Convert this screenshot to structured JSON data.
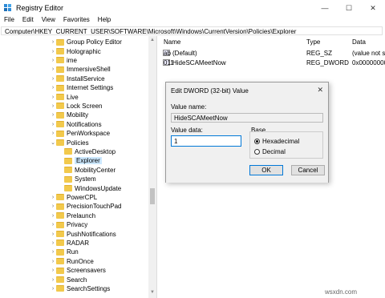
{
  "window": {
    "title": "Registry Editor"
  },
  "menu": [
    "File",
    "Edit",
    "View",
    "Favorites",
    "Help"
  ],
  "address": "Computer\\HKEY_CURRENT_USER\\SOFTWARE\\Microsoft\\Windows\\CurrentVersion\\Policies\\Explorer",
  "tree": [
    {
      "label": "Group Policy Editor",
      "level": 0,
      "expandable": true
    },
    {
      "label": "Holographic",
      "level": 0,
      "expandable": true
    },
    {
      "label": "ime",
      "level": 0,
      "expandable": true
    },
    {
      "label": "ImmersiveShell",
      "level": 0,
      "expandable": true
    },
    {
      "label": "InstallService",
      "level": 0,
      "expandable": true
    },
    {
      "label": "Internet Settings",
      "level": 0,
      "expandable": true
    },
    {
      "label": "Live",
      "level": 0,
      "expandable": true
    },
    {
      "label": "Lock Screen",
      "level": 0,
      "expandable": true
    },
    {
      "label": "Mobility",
      "level": 0,
      "expandable": true
    },
    {
      "label": "Notifications",
      "level": 0,
      "expandable": true
    },
    {
      "label": "PenWorkspace",
      "level": 0,
      "expandable": true
    },
    {
      "label": "Policies",
      "level": 0,
      "expandable": true,
      "expanded": true
    },
    {
      "label": "ActiveDesktop",
      "level": 1,
      "expandable": false
    },
    {
      "label": "Explorer",
      "level": 1,
      "expandable": false,
      "selected": true
    },
    {
      "label": "MobilityCenter",
      "level": 1,
      "expandable": false
    },
    {
      "label": "System",
      "level": 1,
      "expandable": false
    },
    {
      "label": "WindowsUpdate",
      "level": 1,
      "expandable": false
    },
    {
      "label": "PowerCPL",
      "level": 0,
      "expandable": true
    },
    {
      "label": "PrecisionTouchPad",
      "level": 0,
      "expandable": true
    },
    {
      "label": "Prelaunch",
      "level": 0,
      "expandable": true
    },
    {
      "label": "Privacy",
      "level": 0,
      "expandable": true
    },
    {
      "label": "PushNotifications",
      "level": 0,
      "expandable": true
    },
    {
      "label": "RADAR",
      "level": 0,
      "expandable": true
    },
    {
      "label": "Run",
      "level": 0,
      "expandable": true
    },
    {
      "label": "RunOnce",
      "level": 0,
      "expandable": true
    },
    {
      "label": "Screensavers",
      "level": 0,
      "expandable": true
    },
    {
      "label": "Search",
      "level": 0,
      "expandable": true
    },
    {
      "label": "SearchSettings",
      "level": 0,
      "expandable": true
    }
  ],
  "list": {
    "headers": [
      "Name",
      "Type",
      "Data"
    ],
    "rows": [
      {
        "icon": "ab",
        "name": "(Default)",
        "type": "REG_SZ",
        "data": "(value not s"
      },
      {
        "icon": "011",
        "name": "HideSCAMeetNow",
        "type": "REG_DWORD",
        "data": "0x00000000"
      }
    ]
  },
  "dialog": {
    "title": "Edit DWORD (32-bit) Value",
    "close": "✕",
    "value_name_label": "Value name:",
    "value_name": "HideSCAMeetNow",
    "value_data_label": "Value data:",
    "value_data": "1",
    "base_label": "Base",
    "hex_label": "Hexadecimal",
    "dec_label": "Decimal",
    "base_selected": "Hexadecimal",
    "ok": "OK",
    "cancel": "Cancel"
  },
  "watermark": "wsxdn.com"
}
